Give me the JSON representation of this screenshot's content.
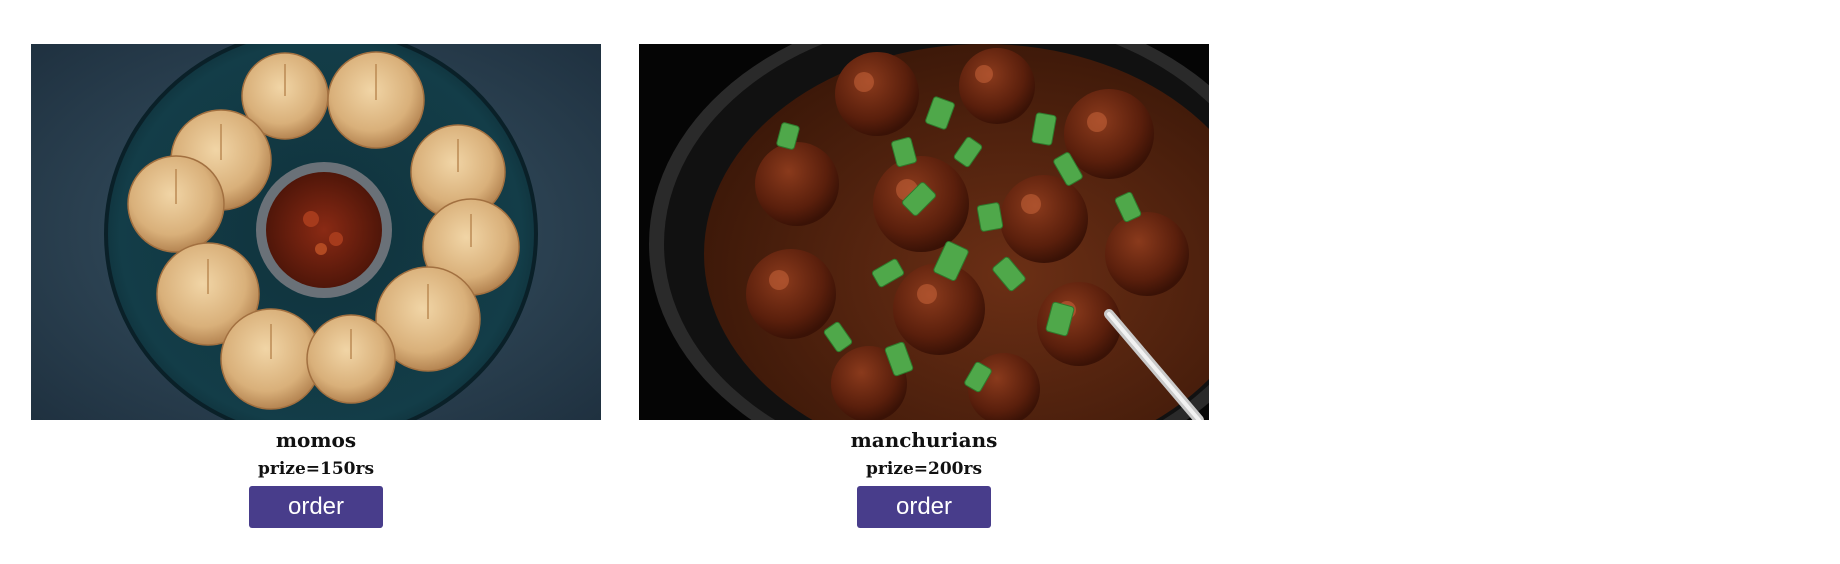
{
  "items": [
    {
      "name": "momos",
      "price": "prize=150rs",
      "button_label": "order",
      "image_icon": "momos-photo"
    },
    {
      "name": "manchurians",
      "price": "prize=200rs",
      "button_label": "order",
      "image_icon": "manchurian-photo"
    }
  ],
  "colors": {
    "button_bg": "#483d8b",
    "button_text": "#ffffff",
    "text": "#111111",
    "background": "#ffffff"
  }
}
